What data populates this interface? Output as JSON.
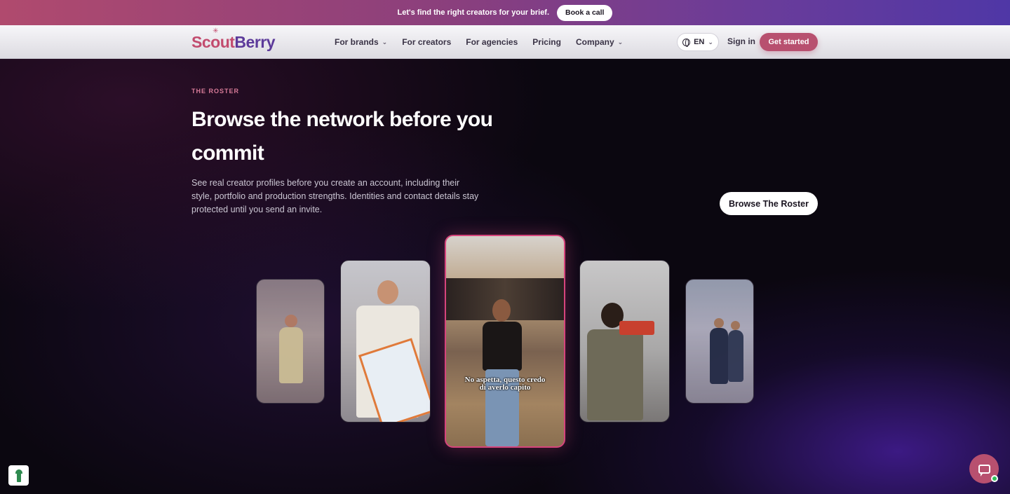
{
  "promo": {
    "text": "Let's find the right creators for your brief.",
    "button": "Book a call"
  },
  "nav": {
    "logo_scout": "Sc",
    "logo_o": "o",
    "logo_ut": "ut",
    "logo_berry": "Berry",
    "links": [
      {
        "label": "For brands",
        "dropdown": true
      },
      {
        "label": "For creators",
        "dropdown": false
      },
      {
        "label": "For agencies",
        "dropdown": false
      },
      {
        "label": "Pricing",
        "dropdown": false
      },
      {
        "label": "Company",
        "dropdown": true
      }
    ],
    "language": "EN",
    "sign_in": "Sign in",
    "get_started": "Get started"
  },
  "hero": {
    "eyebrow": "THE ROSTER",
    "headline": "Browse the network before you commit",
    "description": "See real creator profiles before you create an account, including their style, portfolio and production strengths. Identities and contact details stay protected until you send an invite.",
    "browse_button": "Browse The Roster"
  },
  "cards": {
    "center_caption_line1": "No aspetta, questo credo",
    "center_caption_line2": "di averlo capito"
  },
  "colors": {
    "brand_pink": "#b8506f",
    "brand_purple": "#5c3a9a",
    "accent_border": "#d6457c"
  }
}
